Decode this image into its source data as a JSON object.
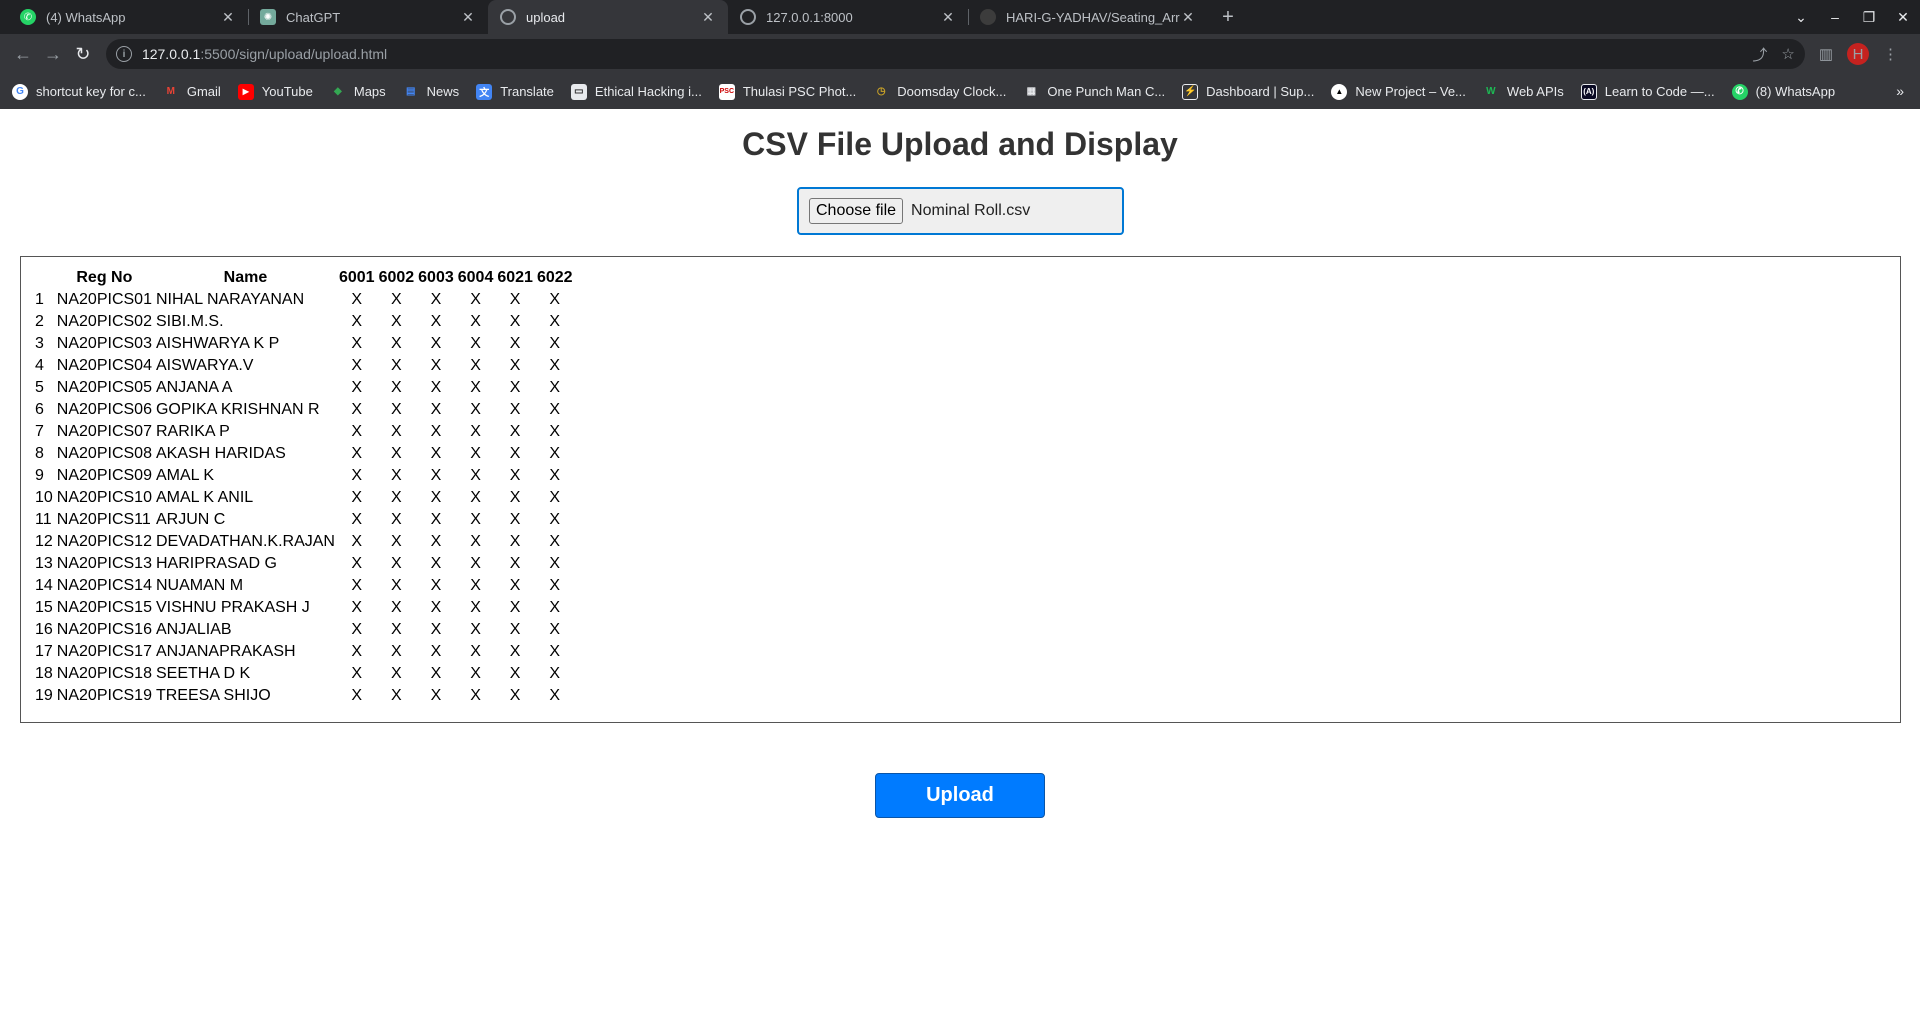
{
  "browser": {
    "tabs": [
      {
        "title": "(4) WhatsApp",
        "icon": "whatsapp-icon",
        "active": false
      },
      {
        "title": "ChatGPT",
        "icon": "chatgpt-icon",
        "active": false
      },
      {
        "title": "upload",
        "icon": "globe-icon",
        "active": true
      },
      {
        "title": "127.0.0.1:8000",
        "icon": "globe-icon",
        "active": false
      },
      {
        "title": "HARI-G-YADHAV/Seating_Arr",
        "icon": "github-icon",
        "active": false
      }
    ],
    "address": {
      "host": "127.0.0.1",
      "path": ":5500/sign/upload/upload.html"
    },
    "profile_initial": "H",
    "bookmarks": [
      {
        "label": "shortcut key for c...",
        "icon": "google-icon",
        "color": "#4285f4"
      },
      {
        "label": "Gmail",
        "icon": "gmail-icon",
        "color": "#ea4335"
      },
      {
        "label": "YouTube",
        "icon": "youtube-icon",
        "color": "#ff0000"
      },
      {
        "label": "Maps",
        "icon": "maps-icon",
        "color": "#34a853"
      },
      {
        "label": "News",
        "icon": "news-icon",
        "color": "#4285f4"
      },
      {
        "label": "Translate",
        "icon": "translate-icon",
        "color": "#4285f4"
      },
      {
        "label": "Ethical Hacking i...",
        "icon": "page-icon",
        "color": "#9aa0a6"
      },
      {
        "label": "Thulasi PSC Phot...",
        "icon": "psc-icon",
        "color": "#e8eaed"
      },
      {
        "label": "Doomsday Clock...",
        "icon": "clock-icon",
        "color": "#c9a227"
      },
      {
        "label": "One Punch Man C...",
        "icon": "building-icon",
        "color": "#e8eaed"
      },
      {
        "label": "Dashboard | Sup...",
        "icon": "dashboard-icon",
        "color": "#3ecf8e"
      },
      {
        "label": "New Project – Ve...",
        "icon": "vercel-icon",
        "color": "#ffffff"
      },
      {
        "label": "Web APIs",
        "icon": "mdn-icon",
        "color": "#1db954"
      },
      {
        "label": "Learn to Code —...",
        "icon": "fcc-icon",
        "color": "#0a0a23"
      },
      {
        "label": "(8) WhatsApp",
        "icon": "whatsapp-icon",
        "color": "#25d366"
      }
    ]
  },
  "page": {
    "title": "CSV File Upload and Display",
    "file_button": "Choose file",
    "file_name": "Nominal Roll.csv",
    "upload_label": "Upload"
  },
  "table": {
    "headers": [
      "",
      "Reg No",
      "Name",
      "6001",
      "6002",
      "6003",
      "6004",
      "6021",
      "6022"
    ],
    "rows": [
      [
        "1",
        "NA20PICS01",
        "NIHAL NARAYANAN",
        "X",
        "X",
        "X",
        "X",
        "X",
        "X"
      ],
      [
        "2",
        "NA20PICS02",
        "SIBI.M.S.",
        "X",
        "X",
        "X",
        "X",
        "X",
        "X"
      ],
      [
        "3",
        "NA20PICS03",
        "AISHWARYA K P",
        "X",
        "X",
        "X",
        "X",
        "X",
        "X"
      ],
      [
        "4",
        "NA20PICS04",
        "AISWARYA.V",
        "X",
        "X",
        "X",
        "X",
        "X",
        "X"
      ],
      [
        "5",
        "NA20PICS05",
        "ANJANA A",
        "X",
        "X",
        "X",
        "X",
        "X",
        "X"
      ],
      [
        "6",
        "NA20PICS06",
        "GOPIKA KRISHNAN R",
        "X",
        "X",
        "X",
        "X",
        "X",
        "X"
      ],
      [
        "7",
        "NA20PICS07",
        "RARIKA P",
        "X",
        "X",
        "X",
        "X",
        "X",
        "X"
      ],
      [
        "8",
        "NA20PICS08",
        "AKASH HARIDAS",
        "X",
        "X",
        "X",
        "X",
        "X",
        "X"
      ],
      [
        "9",
        "NA20PICS09",
        "AMAL K",
        "X",
        "X",
        "X",
        "X",
        "X",
        "X"
      ],
      [
        "10",
        "NA20PICS10",
        "AMAL K ANIL",
        "X",
        "X",
        "X",
        "X",
        "X",
        "X"
      ],
      [
        "11",
        "NA20PICS11",
        "ARJUN C",
        "X",
        "X",
        "X",
        "X",
        "X",
        "X"
      ],
      [
        "12",
        "NA20PICS12",
        "DEVADATHAN.K.RAJAN",
        "X",
        "X",
        "X",
        "X",
        "X",
        "X"
      ],
      [
        "13",
        "NA20PICS13",
        "HARIPRASAD G",
        "X",
        "X",
        "X",
        "X",
        "X",
        "X"
      ],
      [
        "14",
        "NA20PICS14",
        "NUAMAN M",
        "X",
        "X",
        "X",
        "X",
        "X",
        "X"
      ],
      [
        "15",
        "NA20PICS15",
        "VISHNU PRAKASH J",
        "X",
        "X",
        "X",
        "X",
        "X",
        "X"
      ],
      [
        "16",
        "NA20PICS16",
        "ANJALIAB",
        "X",
        "X",
        "X",
        "X",
        "X",
        "X"
      ],
      [
        "17",
        "NA20PICS17",
        "ANJANAPRAKASH",
        "X",
        "X",
        "X",
        "X",
        "X",
        "X"
      ],
      [
        "18",
        "NA20PICS18",
        "SEETHA D K",
        "X",
        "X",
        "X",
        "X",
        "X",
        "X"
      ],
      [
        "19",
        "NA20PICS19",
        "TREESA SHIJO",
        "X",
        "X",
        "X",
        "X",
        "X",
        "X"
      ]
    ]
  }
}
